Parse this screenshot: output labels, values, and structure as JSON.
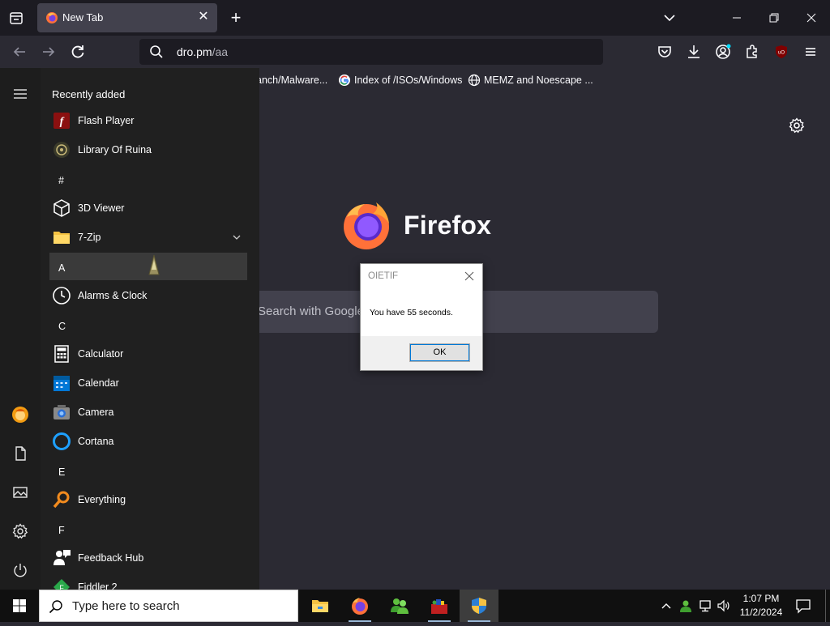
{
  "browser": {
    "tab": {
      "title": "New Tab"
    },
    "url": {
      "host": "dro.pm",
      "path": "/aa"
    },
    "bookmarks": [
      {
        "label": "anch/Malware...",
        "icon": "none"
      },
      {
        "label": "Index of /ISOs/Windows",
        "icon": "google-icon"
      },
      {
        "label": "MEMZ and Noescape ...",
        "icon": "globe-icon"
      }
    ],
    "newtab": {
      "brand": "Firefox",
      "search_placeholder": "Search with Google or enter address"
    },
    "accent": "#ff9400"
  },
  "startmenu": {
    "header": "Recently added",
    "items": [
      {
        "type": "app",
        "label": "Flash Player",
        "icon": "flash-icon"
      },
      {
        "type": "app",
        "label": "Library Of Ruina",
        "icon": "game-icon"
      },
      {
        "type": "letter",
        "label": "#"
      },
      {
        "type": "app",
        "label": "3D Viewer",
        "icon": "cube-icon"
      },
      {
        "type": "app",
        "label": "7-Zip",
        "icon": "folder-icon",
        "expandable": true
      },
      {
        "type": "letter",
        "label": "A",
        "highlighted": true
      },
      {
        "type": "app",
        "label": "Alarms & Clock",
        "icon": "clock-icon"
      },
      {
        "type": "letter",
        "label": "C"
      },
      {
        "type": "app",
        "label": "Calculator",
        "icon": "calculator-icon"
      },
      {
        "type": "app",
        "label": "Calendar",
        "icon": "calendar-icon"
      },
      {
        "type": "app",
        "label": "Camera",
        "icon": "camera-icon"
      },
      {
        "type": "app",
        "label": "Cortana",
        "icon": "cortana-icon"
      },
      {
        "type": "letter",
        "label": "E"
      },
      {
        "type": "app",
        "label": "Everything",
        "icon": "magnifier-icon"
      },
      {
        "type": "letter",
        "label": "F"
      },
      {
        "type": "app",
        "label": "Feedback Hub",
        "icon": "feedback-icon"
      },
      {
        "type": "app",
        "label": "Fiddler 2",
        "icon": "fiddler-icon"
      }
    ]
  },
  "dialog": {
    "title": "OIETIF",
    "message": "You have 55 seconds.",
    "ok_label": "OK"
  },
  "taskbar": {
    "search_placeholder": "Type here to search",
    "apps": [
      "file-explorer-icon",
      "firefox-icon",
      "people-icon",
      "toolbox-icon",
      "shield-icon"
    ],
    "clock": {
      "time": "1:07 PM",
      "date": "11/2/2024"
    }
  }
}
